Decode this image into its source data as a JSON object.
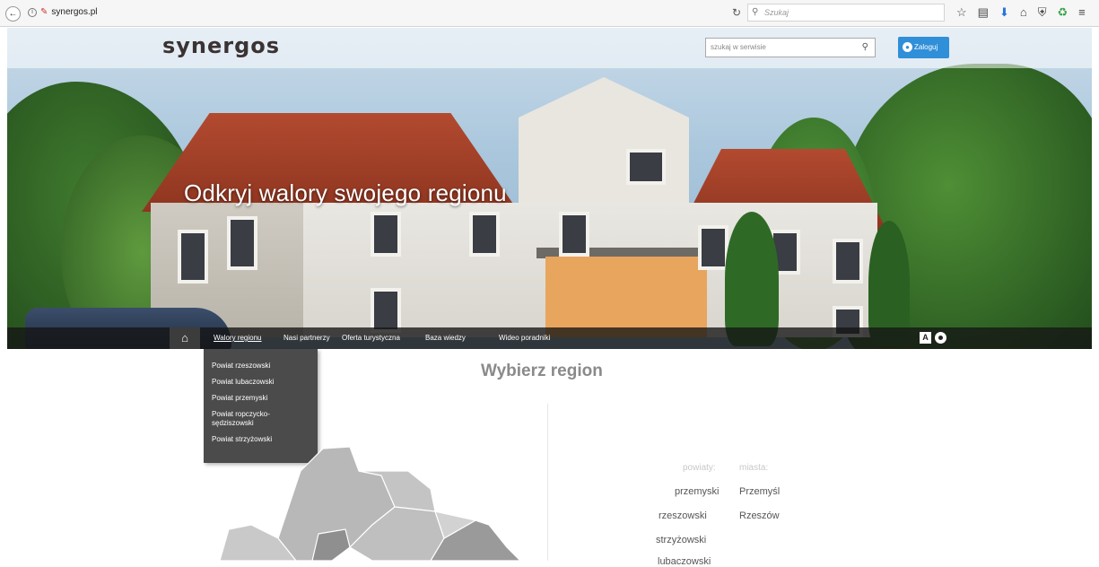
{
  "browser": {
    "url": "synergos.pl",
    "search_placeholder": "Szukaj"
  },
  "header": {
    "logo": "synergos",
    "search_placeholder": "szukaj w serwisie",
    "login_label": "Zaloguj"
  },
  "hero": {
    "title": "Odkryj walory swojego regionu"
  },
  "menu": {
    "items": [
      "Walory regionu",
      "Nasi partnerzy",
      "Oferta turystyczna",
      "Baza wiedzy",
      "Wideo poradniki"
    ],
    "active": "Walory regionu",
    "accessibility_contrast_label": "A"
  },
  "dropdown": {
    "items": [
      "Powiat rzeszowski",
      "Powiat lubaczowski",
      "Powiat przemyski",
      "Powiat ropczycko-sędziszowski",
      "Powiat strzyżowski"
    ]
  },
  "region": {
    "title": "Wybierz region",
    "col_powiaty": "powiaty:",
    "col_miasta": "miasta:",
    "powiaty": [
      "przemyski",
      "rzeszowski",
      "strzyżowski",
      "lubaczowski"
    ],
    "miasta": [
      "Przemyśl",
      "Rzeszów"
    ]
  },
  "colors": {
    "accent": "#2f8fd8",
    "menubar": "#1e1e1e",
    "dropdown": "#4b4b4b"
  }
}
